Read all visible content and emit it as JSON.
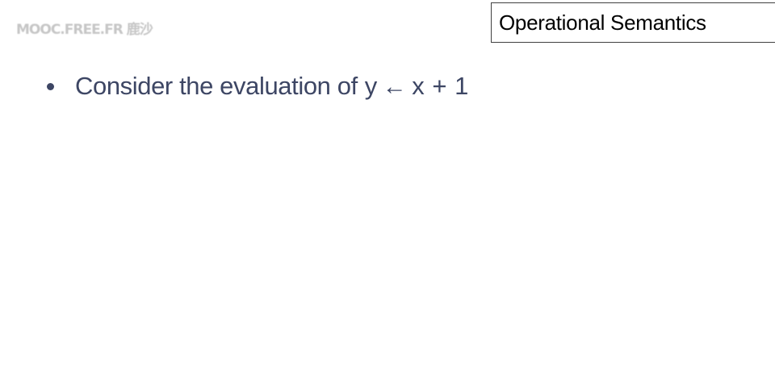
{
  "watermark": {
    "text": "MOOC.FREE.FR 鹿沙"
  },
  "slide": {
    "title": "Operational Semantics",
    "bullets": [
      {
        "text": "Consider the evaluation of",
        "code_left": "y",
        "code_arrow": "←",
        "code_right": "x + 1"
      }
    ]
  },
  "colors": {
    "body_text": "#3d4664",
    "title_text": "#000000",
    "title_border": "#404040",
    "background": "#ffffff"
  }
}
